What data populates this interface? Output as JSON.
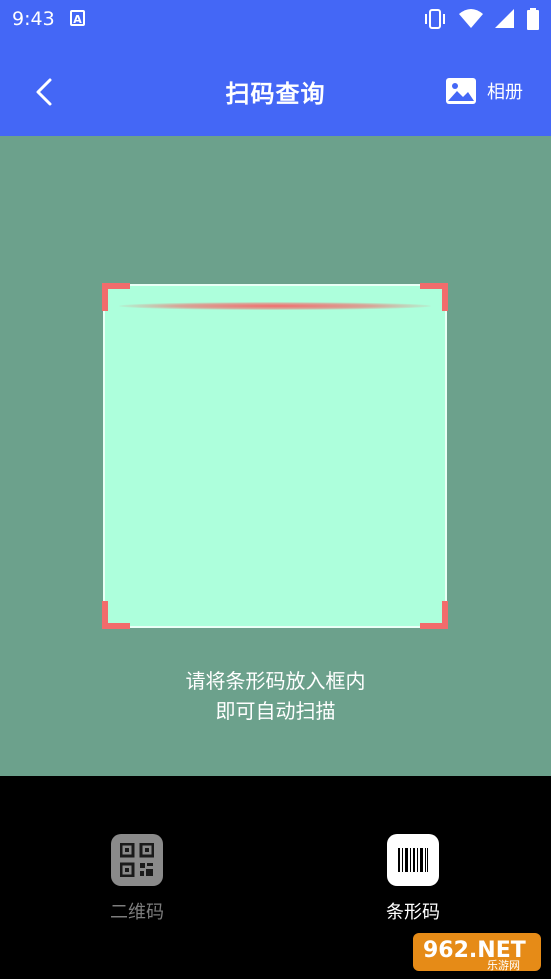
{
  "status_bar": {
    "time": "9:43",
    "notification_icon": "A"
  },
  "header": {
    "title": "扫码查询",
    "album_label": "相册"
  },
  "scanner": {
    "hint_line1": "请将条形码放入框内",
    "hint_line2": "即可自动扫描"
  },
  "modes": [
    {
      "label": "二维码",
      "icon": "qr-code-icon",
      "active": false
    },
    {
      "label": "条形码",
      "icon": "barcode-icon",
      "active": true
    }
  ],
  "watermark": {
    "text": "962.NET",
    "subtext": "乐游网"
  },
  "colors": {
    "header": "#4467f6",
    "scanner_bg": "#6ca18c",
    "frame_fill": "#adffdc",
    "corner": "#f26c6c"
  }
}
